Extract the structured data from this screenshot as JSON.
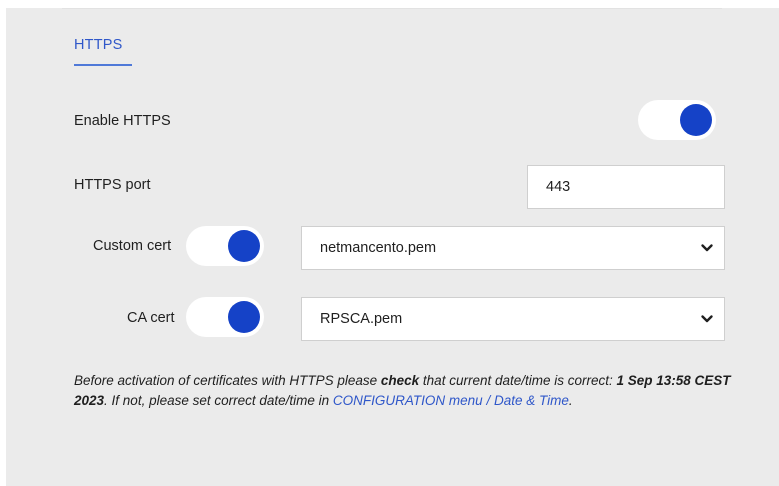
{
  "tab": {
    "label": "HTTPS"
  },
  "enable_https": {
    "label": "Enable HTTPS",
    "on": true
  },
  "https_port": {
    "label": "HTTPS port",
    "value": "443"
  },
  "custom_cert": {
    "label": "Custom cert",
    "on": true,
    "selected": "netmancento.pem"
  },
  "ca_cert": {
    "label": "CA cert",
    "on": true,
    "selected": "RPSCA.pem"
  },
  "note": {
    "part1": "Before activation of certificates with HTTPS please ",
    "check": "check",
    "part2": " that current date/time is correct: ",
    "datetime": "1 Sep 13:58 CEST 2023",
    "part3": ". If not, please set correct date/time in ",
    "link": "CONFIGURATION menu / Date & Time",
    "part4": "."
  },
  "colors": {
    "accent": "#1542c7",
    "link": "#2f57c9",
    "panel_bg": "#ebebeb"
  }
}
